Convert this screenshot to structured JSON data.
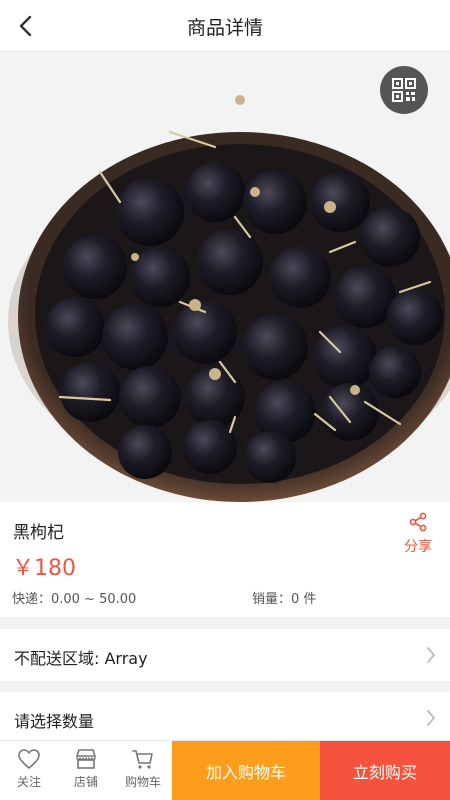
{
  "header": {
    "title": "商品详情",
    "back_icon": "back-arrow-icon"
  },
  "product": {
    "name": "黑枸杞",
    "price": "￥180",
    "express": "快递：0.00 ~ 50.00",
    "sales": "销量：0 件",
    "share_label": "分享",
    "qr_icon": "qr-code-icon",
    "image_description_icon": "product-photo"
  },
  "rows": {
    "delivery_label": "不配送区域: Array",
    "quantity_label": "请选择数量"
  },
  "bottom_bar": {
    "follow_label": "关注",
    "store_label": "店铺",
    "cart_label": "购物车",
    "add_to_cart_label": "加入购物车",
    "buy_now_label": "立刻购买"
  },
  "colors": {
    "accent_red": "#f4543e",
    "accent_orange": "#fc9e1b",
    "background": "#f2f2f2"
  }
}
